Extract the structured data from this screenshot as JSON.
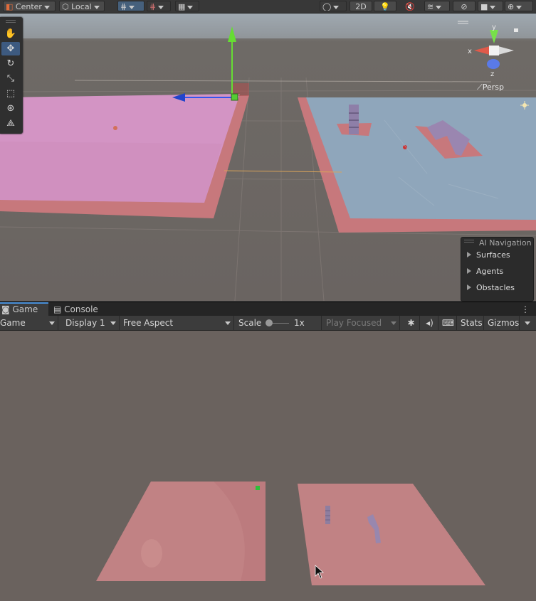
{
  "scene_toolbar": {
    "pivot_label": "Center",
    "space_label": "Local",
    "mode_2d_label": "2D"
  },
  "scene": {
    "camera_label": "Persp",
    "gizmo_axes": {
      "x": "x",
      "y": "y",
      "z": "z"
    },
    "tools": [
      "hand-tool-icon",
      "move-tool-icon",
      "rotate-tool-icon",
      "scale-tool-icon",
      "rect-tool-icon",
      "transform-tool-icon",
      "custom-tool-icon"
    ]
  },
  "ai_navigation": {
    "title": "AI Navigation",
    "items": [
      "Surfaces",
      "Agents",
      "Obstacles"
    ]
  },
  "tabs": {
    "game": "Game",
    "console": "Console"
  },
  "game_toolbar": {
    "mode": "Game",
    "display": "Display 1",
    "aspect": "Free Aspect",
    "scale_label": "Scale",
    "scale_value": "1x",
    "play_mode": "Play Focused",
    "stats": "Stats",
    "gizmos": "Gizmos"
  },
  "colors": {
    "accent": "#3d5a80",
    "pink_plane": "#cf8eb8",
    "blue_plane": "#8fa6bb",
    "navmesh": "#c7787c",
    "game_floor": "#c18284"
  }
}
